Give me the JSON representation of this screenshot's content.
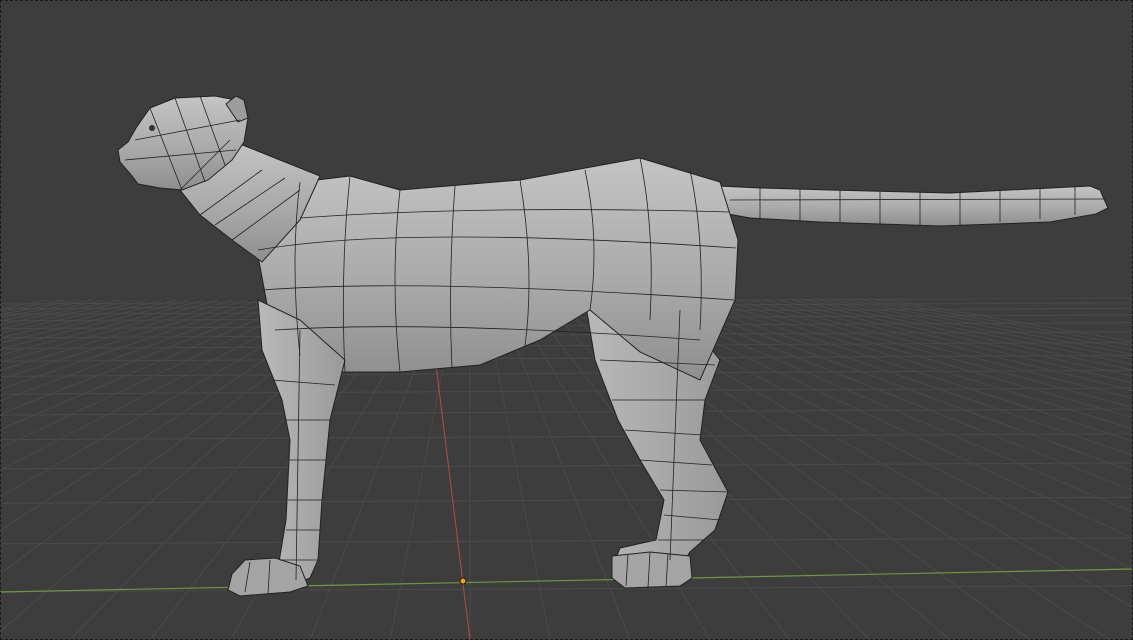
{
  "app": {
    "name": "3D viewport"
  },
  "viewport": {
    "background_color": "#3d3d3d",
    "grid_color": "#4a4a4a",
    "x_axis_color": "#6b9a3a",
    "y_axis_color": "#b34a4a",
    "origin_color": "#f0a020",
    "shading": "solid",
    "overlay": "wireframe"
  },
  "scene": {
    "objects": [
      {
        "name": "cheetah-mesh",
        "type": "mesh",
        "color": "#a8a8a8",
        "wire_color": "#1f1f1f",
        "view": "side"
      }
    ]
  }
}
